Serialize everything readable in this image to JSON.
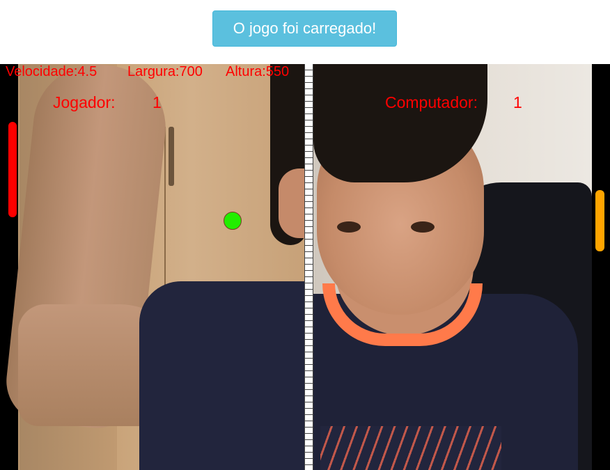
{
  "status": {
    "button_label": "O jogo foi carregado!"
  },
  "hud": {
    "speed": "Velocidade:4.5",
    "width": "Largura:700",
    "height": "Altura:550"
  },
  "scoreboard": {
    "player_label": "Jogador:",
    "player_score": "1",
    "computer_label": "Computador:",
    "computer_score": "1"
  },
  "colors": {
    "status_button": "#5bc0de",
    "hud_text": "#ff0000",
    "player_paddle": "#ff0000",
    "computer_paddle": "#ffa500",
    "ball": "#22ee00"
  },
  "icons": {
    "ball": "ball-icon"
  }
}
